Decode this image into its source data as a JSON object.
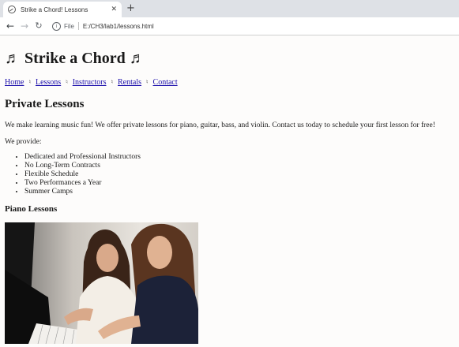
{
  "browser": {
    "tab_title": "Strike a Chord! Lessons",
    "tab_close": "✕",
    "new_tab": "+",
    "address_scheme_label": "File",
    "address_url": "E:/CH3/lab1/lessons.html",
    "icons": {
      "favicon": "globe-icon",
      "back": "arrow-left-icon",
      "forward": "arrow-right-icon",
      "reload": "reload-icon",
      "info": "info-icon"
    }
  },
  "page": {
    "title": "♬ Strike a Chord ♬",
    "nav": {
      "items": [
        "Home",
        "Lessons",
        "Instructors",
        "Rentals",
        "Contact"
      ],
      "separator": "♮"
    },
    "section_heading": "Private Lessons",
    "intro": "We make learning music fun! We offer private lessons for piano, guitar, bass, and violin. Contact us today to schedule your first lesson for free!",
    "provide_label": "We provide:",
    "features": [
      "Dedicated and Professional Instructors",
      "No Long-Term Contracts",
      "Flexible Schedule",
      "Two Performances a Year",
      "Summer Camps"
    ],
    "subheading": "Piano Lessons"
  },
  "colors": {
    "link": "#1a0dab",
    "tabstrip": "#dee1e6",
    "page_background": "#fdfcfb"
  }
}
